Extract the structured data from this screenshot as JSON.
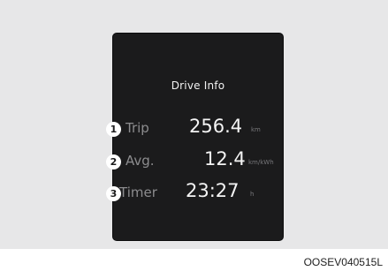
{
  "display": {
    "title": "Drive Info",
    "rows": [
      {
        "number": "1",
        "label": "Trip",
        "value": "256.4",
        "unit": "km"
      },
      {
        "number": "2",
        "label": "Avg.",
        "value": "12.4",
        "unit": "km/kWh"
      },
      {
        "number": "3",
        "label": "Timer",
        "value": "23:27",
        "unit": "h"
      }
    ]
  },
  "caption": "OOSEV040515L",
  "colors": {
    "background": "#e7e7e8",
    "display": "#1b1b1c",
    "text": "#f4f4f4",
    "label": "#8c8c8e"
  }
}
